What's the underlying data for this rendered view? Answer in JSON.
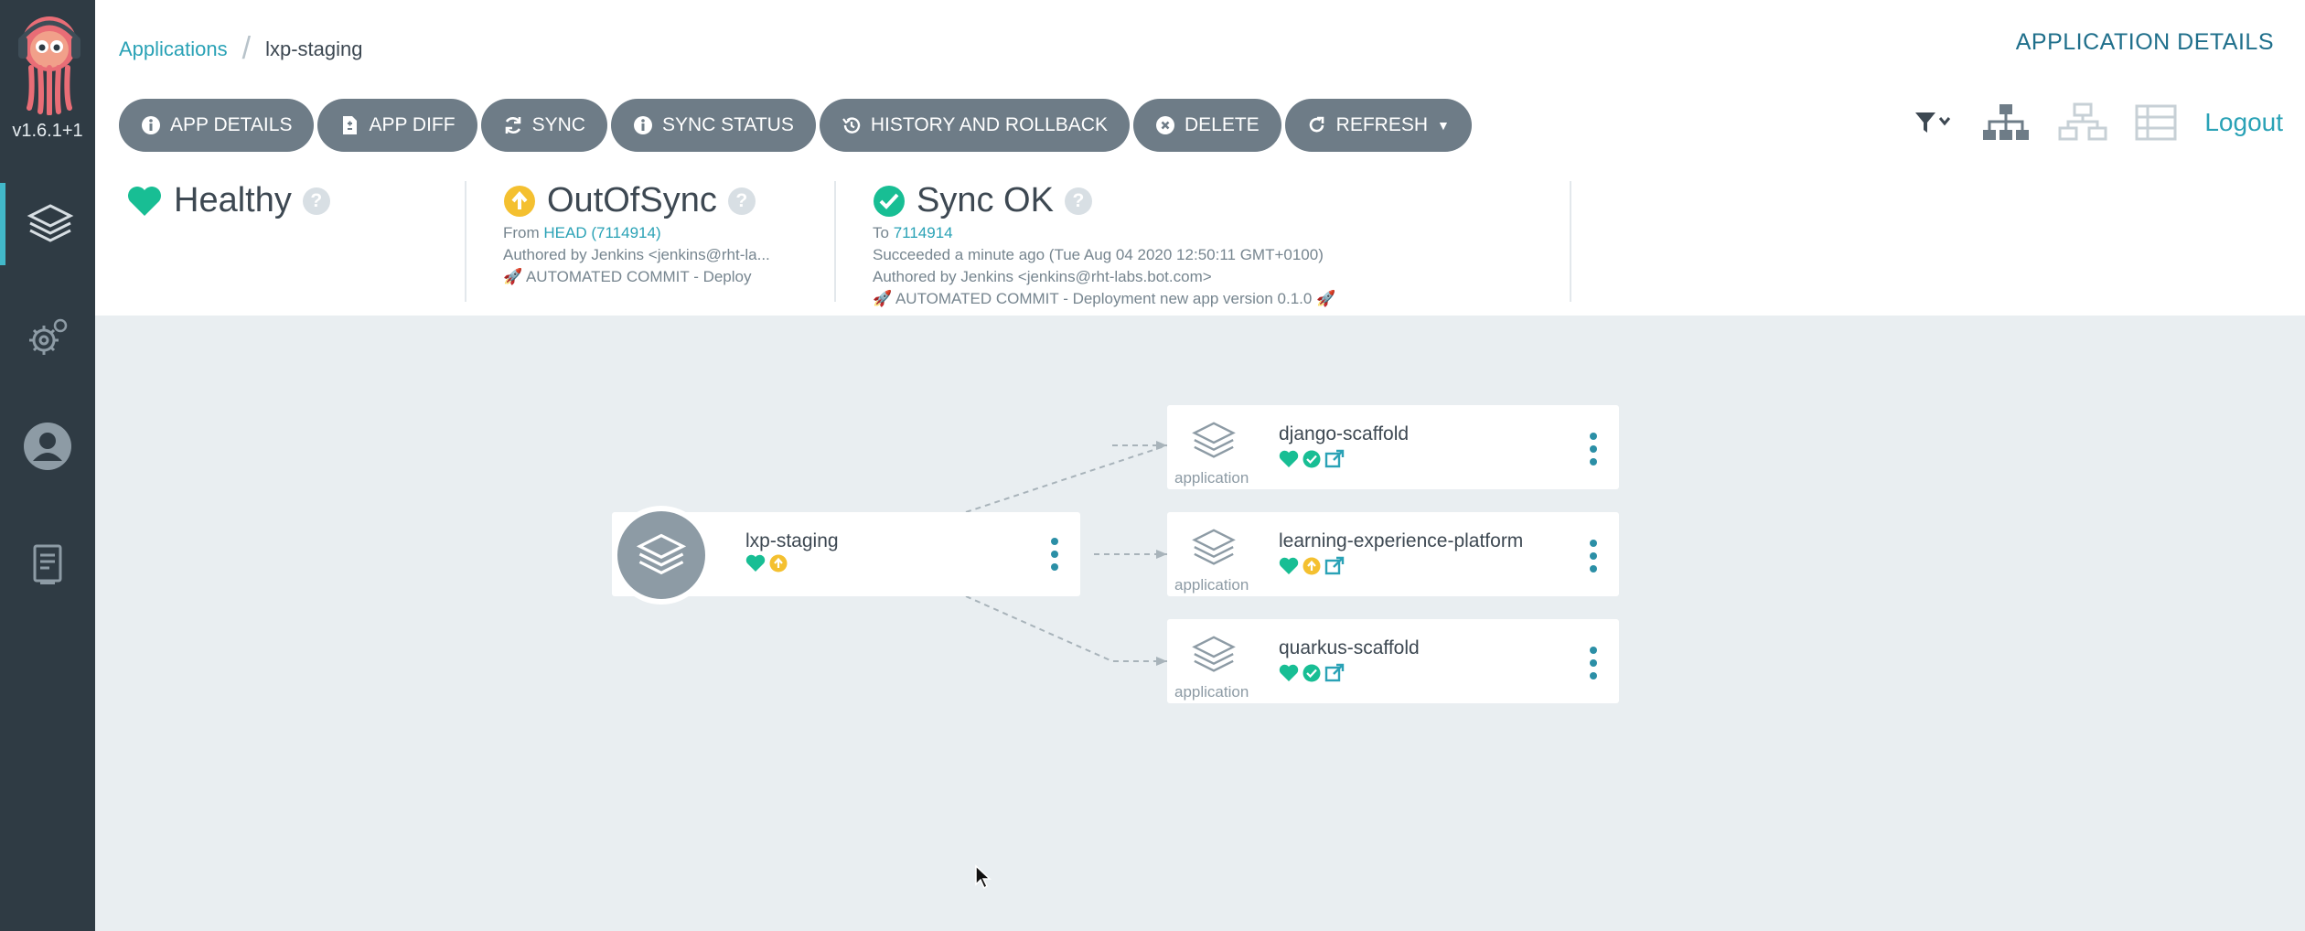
{
  "sidebar": {
    "version": "v1.6.1+1",
    "items": [
      {
        "icon": "layers-icon",
        "active": true
      },
      {
        "icon": "settings-gears-icon",
        "active": false
      },
      {
        "icon": "user-icon",
        "active": false
      },
      {
        "icon": "docs-icon",
        "active": false
      }
    ]
  },
  "header": {
    "breadcrumb": {
      "root": "Applications",
      "current": "lxp-staging"
    },
    "title": "APPLICATION DETAILS",
    "logout": "Logout"
  },
  "toolbar": {
    "buttons": [
      {
        "label": "APP DETAILS",
        "icon": "info-icon"
      },
      {
        "label": "APP DIFF",
        "icon": "file-diff-icon"
      },
      {
        "label": "SYNC",
        "icon": "sync-icon"
      },
      {
        "label": "SYNC STATUS",
        "icon": "info-icon"
      },
      {
        "label": "HISTORY AND ROLLBACK",
        "icon": "history-icon"
      },
      {
        "label": "DELETE",
        "icon": "times-circle-icon"
      },
      {
        "label": "REFRESH",
        "icon": "redo-icon"
      }
    ]
  },
  "status": {
    "health": {
      "label": "Healthy",
      "color": "#18be94"
    },
    "sync": {
      "label": "OutOfSync",
      "color": "#f4c030",
      "from_prefix": "From",
      "from_link": "HEAD (7114914)",
      "author": "Authored by Jenkins <jenkins@rht-la...",
      "commit": "AUTOMATED COMMIT - Deploy"
    },
    "operation": {
      "label": "Sync OK",
      "color": "#18be94",
      "to_prefix": "To",
      "to_link": "7114914",
      "time": "Succeeded a minute ago (Tue Aug 04 2020 12:50:11 GMT+0100)",
      "author": "Authored by Jenkins <jenkins@rht-labs.bot.com>",
      "commit": "AUTOMATED COMMIT - Deployment new app version 0.1.0"
    }
  },
  "graph": {
    "root": {
      "name": "lxp-staging"
    },
    "children": [
      {
        "name": "django-scaffold",
        "kind": "application",
        "status": "synced"
      },
      {
        "name": "learning-experience-platform",
        "kind": "application",
        "status": "out-of-sync"
      },
      {
        "name": "quarkus-scaffold",
        "kind": "application",
        "status": "synced"
      }
    ]
  },
  "colors": {
    "sidebar": "#2f3b44",
    "accent": "#2aa2b6",
    "button": "#6e7c87",
    "healthy": "#18be94",
    "outofsync": "#f4c030",
    "background": "#e9eef1"
  }
}
